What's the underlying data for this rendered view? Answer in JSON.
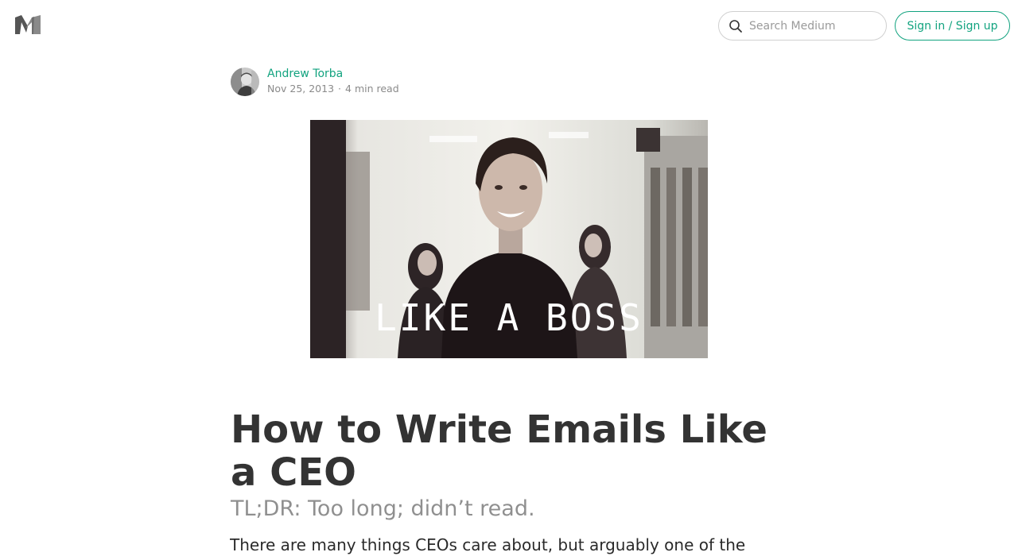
{
  "header": {
    "logo_icon": "medium-logo-icon",
    "search": {
      "icon": "search-icon",
      "placeholder": "Search Medium"
    },
    "signin_label": "Sign in / Sign up"
  },
  "author": {
    "name": "Andrew Torba",
    "date": "Nov 25, 2013",
    "separator": "·",
    "read_time": "4 min read"
  },
  "hero": {
    "caption": "LIKE A BOSS"
  },
  "article": {
    "title": "How to Write Emails Like a CEO",
    "subtitle": "TL;DR: Too long; didn’t read.",
    "body_first_line": "There are many things CEOs care about, but arguably one of the"
  },
  "colors": {
    "accent": "#12a37f",
    "text": "#333333",
    "muted": "#8a8a8a"
  }
}
